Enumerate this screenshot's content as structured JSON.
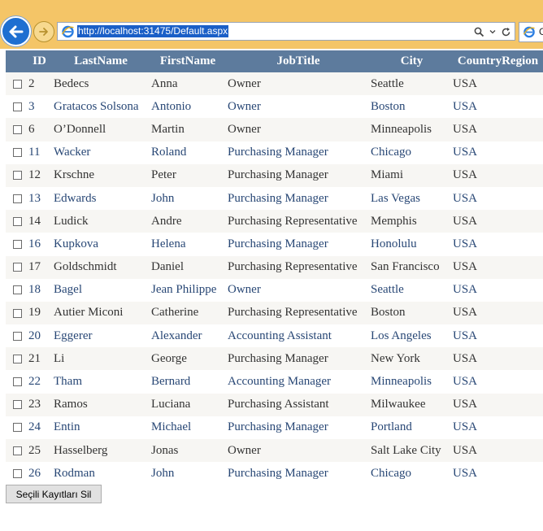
{
  "browser": {
    "url": "http://localhost:31475/Default.aspx",
    "tab_title": "G"
  },
  "grid": {
    "headers": {
      "id": "ID",
      "lastname": "LastName",
      "firstname": "FirstName",
      "jobtitle": "JobTitle",
      "city": "City",
      "country": "CountryRegion"
    },
    "rows": [
      {
        "id": "2",
        "last": "Bedecs",
        "first": "Anna",
        "job": "Owner",
        "city": "Seattle",
        "country": "USA"
      },
      {
        "id": "3",
        "last": "Gratacos Solsona",
        "first": "Antonio",
        "job": "Owner",
        "city": "Boston",
        "country": "USA"
      },
      {
        "id": "6",
        "last": "O’Donnell",
        "first": "Martin",
        "job": "Owner",
        "city": "Minneapolis",
        "country": "USA"
      },
      {
        "id": "11",
        "last": "Wacker",
        "first": "Roland",
        "job": "Purchasing Manager",
        "city": "Chicago",
        "country": "USA"
      },
      {
        "id": "12",
        "last": "Krschne",
        "first": "Peter",
        "job": "Purchasing Manager",
        "city": "Miami",
        "country": "USA"
      },
      {
        "id": "13",
        "last": "Edwards",
        "first": "John",
        "job": "Purchasing Manager",
        "city": "Las Vegas",
        "country": "USA"
      },
      {
        "id": "14",
        "last": "Ludick",
        "first": "Andre",
        "job": "Purchasing Representative",
        "city": "Memphis",
        "country": "USA"
      },
      {
        "id": "16",
        "last": "Kupkova",
        "first": "Helena",
        "job": "Purchasing Manager",
        "city": "Honolulu",
        "country": "USA"
      },
      {
        "id": "17",
        "last": "Goldschmidt",
        "first": "Daniel",
        "job": "Purchasing Representative",
        "city": "San Francisco",
        "country": "USA"
      },
      {
        "id": "18",
        "last": "Bagel",
        "first": "Jean Philippe",
        "job": "Owner",
        "city": "Seattle",
        "country": "USA"
      },
      {
        "id": "19",
        "last": "Autier Miconi",
        "first": "Catherine",
        "job": "Purchasing Representative",
        "city": "Boston",
        "country": "USA"
      },
      {
        "id": "20",
        "last": "Eggerer",
        "first": "Alexander",
        "job": "Accounting Assistant",
        "city": "Los Angeles",
        "country": "USA"
      },
      {
        "id": "21",
        "last": "Li",
        "first": "George",
        "job": "Purchasing Manager",
        "city": "New York",
        "country": "USA"
      },
      {
        "id": "22",
        "last": "Tham",
        "first": "Bernard",
        "job": "Accounting Manager",
        "city": "Minneapolis",
        "country": "USA"
      },
      {
        "id": "23",
        "last": "Ramos",
        "first": "Luciana",
        "job": "Purchasing Assistant",
        "city": "Milwaukee",
        "country": "USA"
      },
      {
        "id": "24",
        "last": "Entin",
        "first": "Michael",
        "job": "Purchasing Manager",
        "city": "Portland",
        "country": "USA"
      },
      {
        "id": "25",
        "last": "Hasselberg",
        "first": "Jonas",
        "job": "Owner",
        "city": "Salt Lake City",
        "country": "USA"
      },
      {
        "id": "26",
        "last": "Rodman",
        "first": "John",
        "job": "Purchasing Manager",
        "city": "Chicago",
        "country": "USA"
      }
    ]
  },
  "actions": {
    "delete_selected_label": "Seçili Kayıtları Sil"
  },
  "colors": {
    "header_bg": "#5d7b9d",
    "row_odd_bg": "#f7f6f3",
    "row_even_text": "#284775",
    "toolbar_bg": "#f4c567"
  }
}
